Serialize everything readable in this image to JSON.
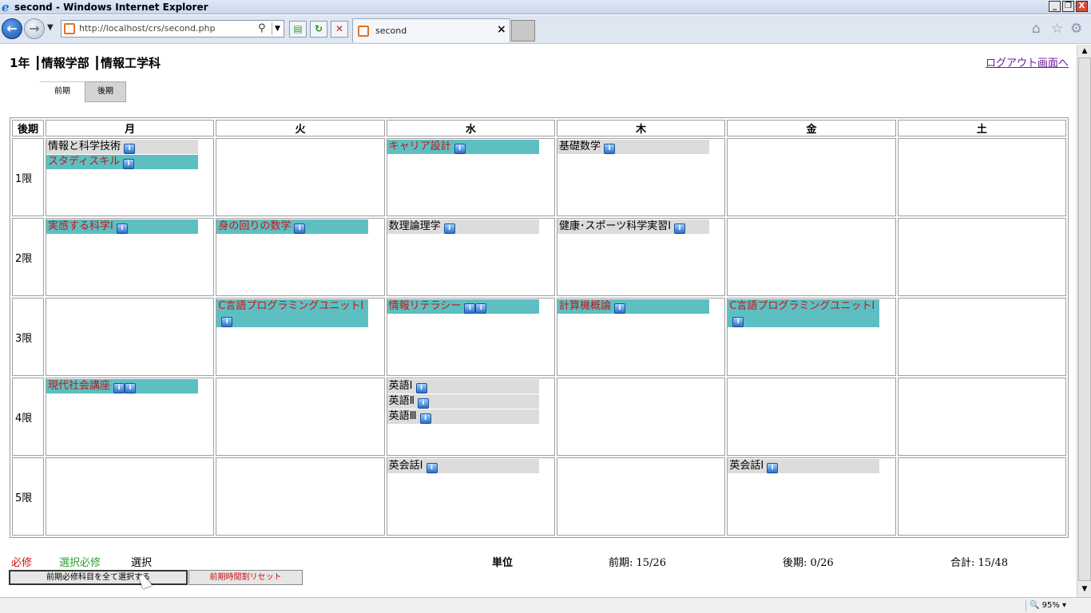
{
  "window": {
    "title": "second - Windows Internet Explorer",
    "minimize": "_",
    "restore": "❐",
    "close": "X"
  },
  "browser": {
    "url": "http://localhost/crs/second.php",
    "tab_label": "second",
    "tab_close": "×",
    "zoom": "95%"
  },
  "header": {
    "title": "1年 ┃情報学部 ┃情報工学科",
    "logout": "ログアウト画面へ"
  },
  "term_tabs": [
    "前期",
    "後期"
  ],
  "timetable": {
    "corner": "後期",
    "days": [
      "月",
      "火",
      "水",
      "木",
      "金",
      "土"
    ],
    "periods": [
      {
        "label": "1限",
        "cells": [
          [
            {
              "name": "情報と科学技術",
              "kind": "sel",
              "icons": 1
            },
            {
              "name": "スタディスキル",
              "kind": "req",
              "icons": 1
            }
          ],
          [],
          [
            {
              "name": "キャリア設計",
              "kind": "req",
              "icons": 1
            }
          ],
          [
            {
              "name": "基礎数学",
              "kind": "sel",
              "icons": 1
            }
          ],
          [],
          []
        ]
      },
      {
        "label": "2限",
        "cells": [
          [
            {
              "name": "実感する科学Ⅰ",
              "kind": "req",
              "icons": 1
            }
          ],
          [
            {
              "name": "身の回りの数学",
              "kind": "req",
              "icons": 1
            }
          ],
          [
            {
              "name": "数理論理学",
              "kind": "sel",
              "icons": 1
            }
          ],
          [
            {
              "name": "健康･スポーツ科学実習Ⅰ",
              "kind": "sel",
              "icons": 1
            }
          ],
          [],
          []
        ]
      },
      {
        "label": "3限",
        "cells": [
          [],
          [
            {
              "name": "C言語プログラミングユニットⅠ",
              "kind": "req",
              "icons": 1
            }
          ],
          [
            {
              "name": "情報リテラシー",
              "kind": "req",
              "icons": 2
            }
          ],
          [
            {
              "name": "計算機概論",
              "kind": "req",
              "icons": 1
            }
          ],
          [
            {
              "name": "C言語プログラミングユニットⅠ",
              "kind": "req",
              "icons": 1
            }
          ],
          []
        ]
      },
      {
        "label": "4限",
        "cells": [
          [
            {
              "name": "現代社会講座",
              "kind": "req",
              "icons": 2
            }
          ],
          [],
          [
            {
              "name": "英語Ⅰ",
              "kind": "sel",
              "icons": 1
            },
            {
              "name": "英語Ⅱ",
              "kind": "sel",
              "icons": 1
            },
            {
              "name": "英語Ⅲ",
              "kind": "sel",
              "icons": 1
            }
          ],
          [],
          [],
          []
        ]
      },
      {
        "label": "5限",
        "cells": [
          [],
          [],
          [
            {
              "name": "英会話Ⅰ",
              "kind": "sel",
              "icons": 1
            }
          ],
          [],
          [
            {
              "name": "英会話Ⅰ",
              "kind": "sel",
              "icons": 1
            }
          ],
          []
        ]
      }
    ]
  },
  "legend": {
    "required": "必修",
    "selective_required": "選択必修",
    "selective": "選択"
  },
  "units": {
    "label": "単位",
    "zenki": "前期: 15/26",
    "kouki": "後期: 0/26",
    "total": "合計: 15/48"
  },
  "buttons": {
    "select_all": "前期必修科目を全て選択する",
    "reset": "前期時間割リセット"
  },
  "colors": {
    "required_bg": "#5ebfc2",
    "required_text": "#c81414",
    "selective_bg": "#dcdcdc",
    "legend_required": "#d01010",
    "legend_selective_required": "#2aa02a"
  },
  "icons": {
    "course_info": "info-icon",
    "back": "back-arrow-icon",
    "forward": "forward-arrow-icon",
    "home": "home-icon",
    "favorites": "star-icon",
    "tools": "gear-icon"
  }
}
